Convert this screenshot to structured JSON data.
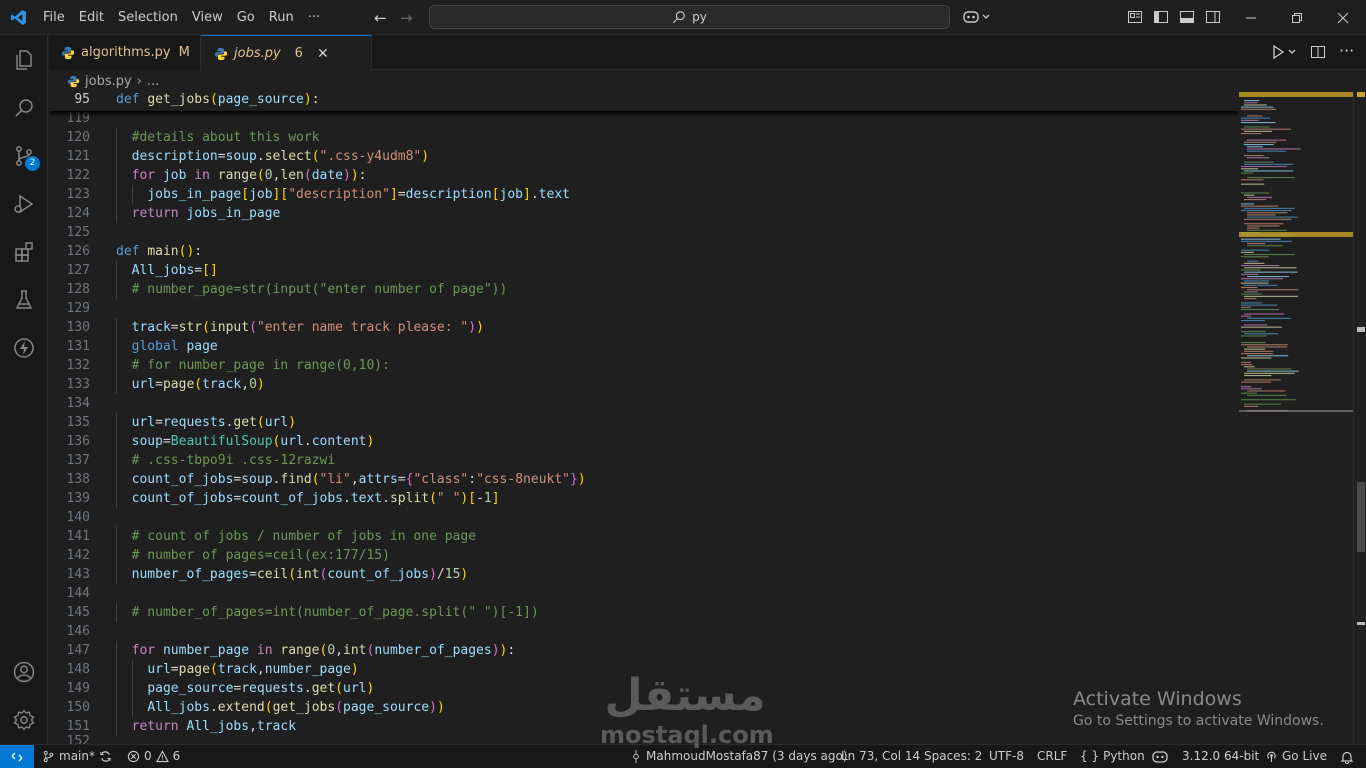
{
  "menu": [
    "File",
    "Edit",
    "Selection",
    "View",
    "Go",
    "Run",
    "···"
  ],
  "search": {
    "text": "py"
  },
  "tabs": [
    {
      "name": "algorithms.py",
      "status": "M"
    },
    {
      "name": "jobs.py",
      "status": "6"
    }
  ],
  "breadcrumb": {
    "file": "jobs.py",
    "more": "..."
  },
  "source_control_badge": "2",
  "sticky_line": {
    "number": "95",
    "code": "def get_jobs(page_source):"
  },
  "partial_line_number": "119",
  "last_partial_line_number": "152",
  "lines": [
    {
      "n": "120",
      "code": "  #details about this work"
    },
    {
      "n": "121",
      "code": "  description=soup.select(\".css-y4udm8\")"
    },
    {
      "n": "122",
      "code": "  for job in range(0,len(date)):"
    },
    {
      "n": "123",
      "code": "    jobs_in_page[job][\"description\"]=description[job].text"
    },
    {
      "n": "124",
      "code": "  return jobs_in_page"
    },
    {
      "n": "125",
      "code": ""
    },
    {
      "n": "126",
      "code": "def main():"
    },
    {
      "n": "127",
      "code": "  All_jobs=[]"
    },
    {
      "n": "128",
      "code": "  # number_page=str(input(\"enter number of page\"))"
    },
    {
      "n": "129",
      "code": ""
    },
    {
      "n": "130",
      "code": "  track=str(input(\"enter name track please: \"))"
    },
    {
      "n": "131",
      "code": "  global page"
    },
    {
      "n": "132",
      "code": "  # for number_page in range(0,10):"
    },
    {
      "n": "133",
      "code": "  url=page(track,0)"
    },
    {
      "n": "134",
      "code": ""
    },
    {
      "n": "135",
      "code": "  url=requests.get(url)"
    },
    {
      "n": "136",
      "code": "  soup=BeautifulSoup(url.content)"
    },
    {
      "n": "137",
      "code": "  # .css-tbpo9i .css-12razwi"
    },
    {
      "n": "138",
      "code": "  count_of_jobs=soup.find(\"li\",attrs={\"class\":\"css-8neukt\"})"
    },
    {
      "n": "139",
      "code": "  count_of_jobs=count_of_jobs.text.split(\" \")[-1]"
    },
    {
      "n": "140",
      "code": ""
    },
    {
      "n": "141",
      "code": "  # count of jobs / number of jobs in one page"
    },
    {
      "n": "142",
      "code": "  # number of pages=ceil(ex:177/15)"
    },
    {
      "n": "143",
      "code": "  number_of_pages=ceil(int(count_of_jobs)/15)"
    },
    {
      "n": "144",
      "code": ""
    },
    {
      "n": "145",
      "code": "  # number_of_pages=int(number_of_page.split(\" \")[-1])"
    },
    {
      "n": "146",
      "code": ""
    },
    {
      "n": "147",
      "code": "  for number_page in range(0,int(number_of_pages)):"
    },
    {
      "n": "148",
      "code": "    url=page(track,number_page)"
    },
    {
      "n": "149",
      "code": "    page_source=requests.get(url)"
    },
    {
      "n": "150",
      "code": "    All_jobs.extend(get_jobs(page_source))"
    },
    {
      "n": "151",
      "code": "  return All_jobs,track"
    }
  ],
  "status": {
    "branch": "main*",
    "errors": "0",
    "warnings": "6",
    "author": "MahmoudMostafa87 (3 days ago)",
    "position": "Ln 73, Col 14",
    "spaces": "Spaces: 2",
    "encoding": "UTF-8",
    "eol": "CRLF",
    "language": "Python",
    "interpreter": "3.12.0 64-bit",
    "golive": "Go Live"
  },
  "watermark": {
    "activate_title": "Activate Windows",
    "activate_sub": "Go to Settings to activate Windows.",
    "site_ar": "مستقل",
    "site_en": "mostaql.com"
  },
  "colors": {
    "accent": "#0078d4",
    "modified": "#e2c08d",
    "background": "#1f1f1f"
  }
}
